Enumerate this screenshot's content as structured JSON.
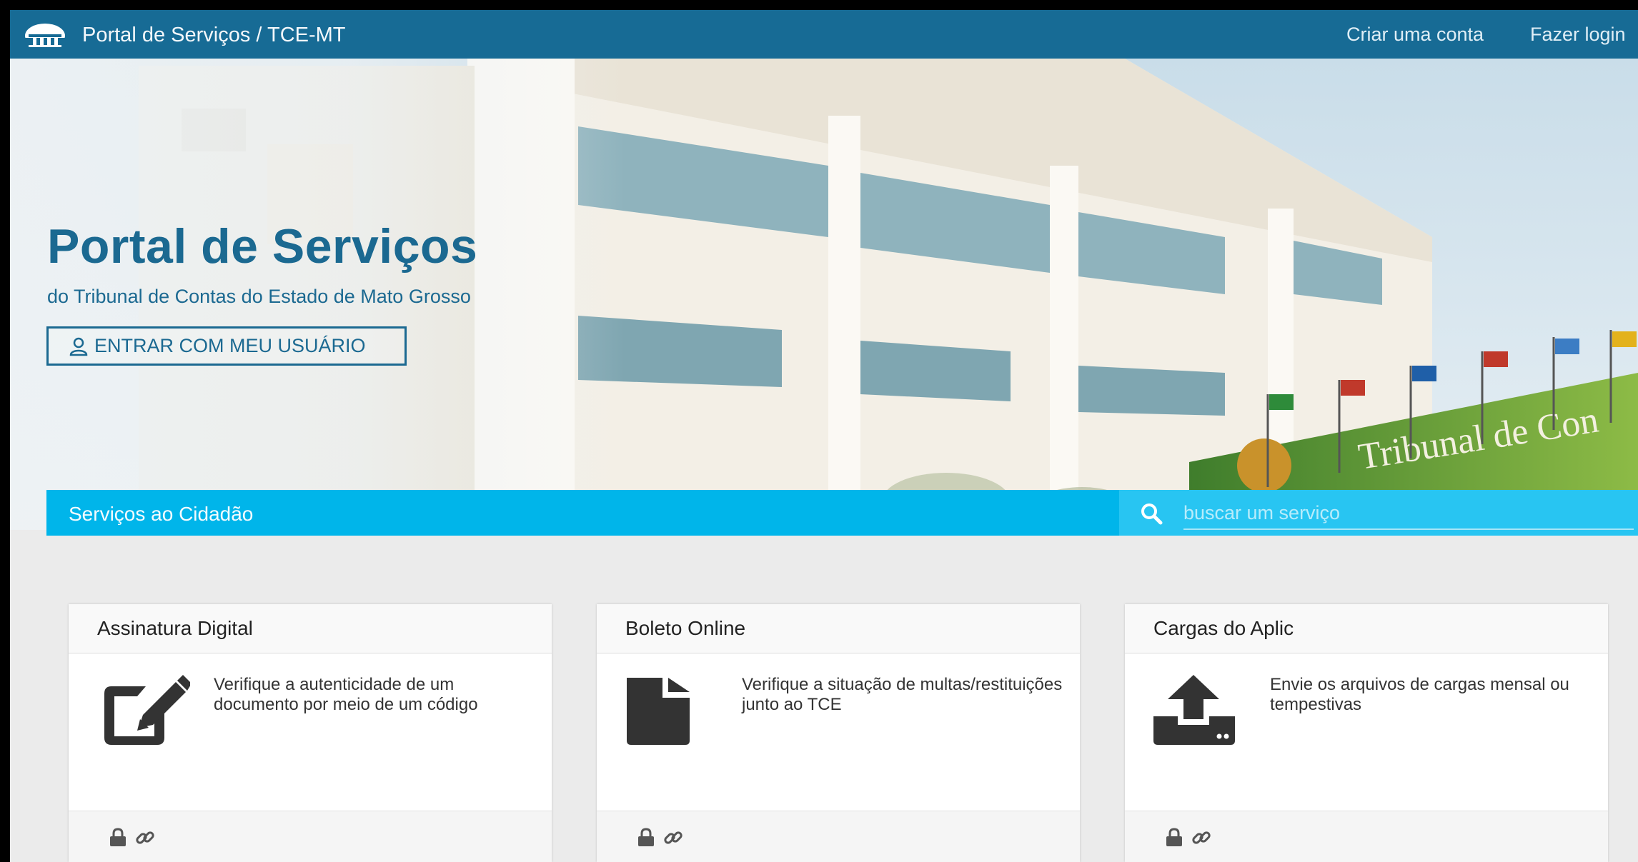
{
  "header": {
    "app_title": "Portal de Serviços / TCE-MT",
    "create_account": "Criar uma conta",
    "login": "Fazer login",
    "logo_icon": "tce-logo-icon"
  },
  "hero": {
    "title": "Portal de Serviços",
    "subtitle": "do Tribunal de Contas do Estado de Mato Grosso",
    "enter_button": "ENTRAR COM MEU USUÁRIO",
    "enter_icon": "user-icon",
    "building_sign": "Tribunal de Con"
  },
  "services_bar": {
    "label": "Serviços ao Cidadão",
    "search_placeholder": "buscar um serviço",
    "search_icon": "search-icon"
  },
  "cards": [
    {
      "title": "Assinatura Digital",
      "description": "Verifique a autenticidade de um documento por meio de um código",
      "icon": "edit-icon"
    },
    {
      "title": "Boleto Online",
      "description": "Verifique a situação de multas/restituições junto ao TCE",
      "icon": "file-icon"
    },
    {
      "title": "Cargas do Aplic",
      "description": "Envie os arquivos de cargas mensal ou tempestivas",
      "icon": "upload-icon"
    }
  ],
  "colors": {
    "topbar": "#176b95",
    "brand_text": "#1b6991",
    "services_bar": "#00b5ea",
    "search_bg": "#28c5f2",
    "page_bg": "#ebebeb"
  }
}
